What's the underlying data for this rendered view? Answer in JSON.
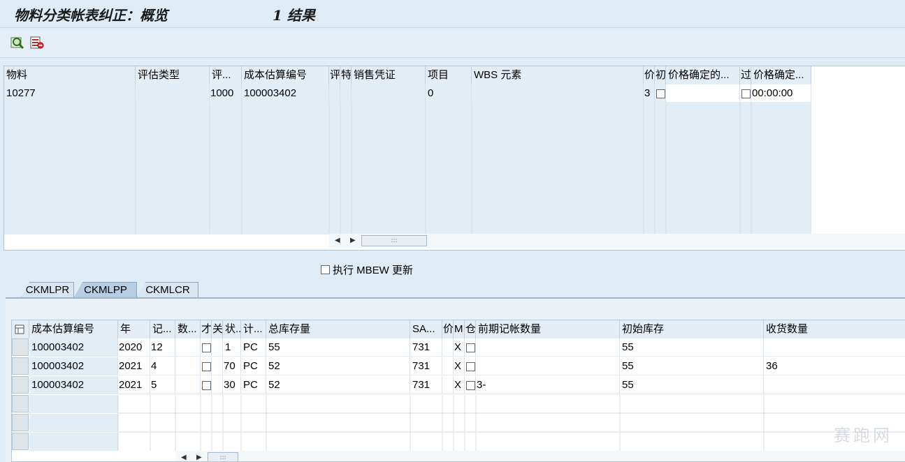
{
  "header": {
    "title": "物料分类帐表纠正：概览",
    "results": "1 结果"
  },
  "toolbar": {
    "buttons": [
      {
        "icon": "zoom-details-icon"
      },
      {
        "icon": "layout-list-icon"
      }
    ]
  },
  "top_table": {
    "columns": [
      "物料",
      "评估类型",
      "评...",
      "成本估算编号",
      "评",
      "特",
      "销售凭证",
      "项目",
      "WBS 元素",
      "价",
      "初",
      "价格确定的...",
      "过",
      "价格确定..."
    ],
    "rows": [
      [
        "10277",
        "",
        "1000",
        "100003402",
        "",
        "",
        "",
        "0",
        "",
        "3",
        "",
        "",
        "",
        "00:00:00"
      ]
    ]
  },
  "mbew_option": {
    "label": "执行 MBEW 更新",
    "checked": false
  },
  "tabs": [
    {
      "label": "CKMLPR"
    },
    {
      "label": "CKMLPP",
      "active": true
    },
    {
      "label": "CKMLCR"
    }
  ],
  "bottom_table": {
    "columns": [
      "成本估算编号",
      "年",
      "记...",
      "数...",
      "才",
      "关",
      "状...",
      "计...",
      "总库存量",
      "SA...",
      "价",
      "M",
      "仓",
      "前期记帐数量",
      "初始库存",
      "收货数量"
    ],
    "rows": [
      [
        "100003402",
        "2020",
        "12",
        "",
        "",
        "",
        "1",
        "PC",
        "55",
        "731",
        "",
        "X",
        "",
        "",
        "55",
        ""
      ],
      [
        "100003402",
        "2021",
        "4",
        "",
        "",
        "",
        "70",
        "PC",
        "52",
        "731",
        "",
        "X",
        "",
        "",
        "55",
        "36"
      ],
      [
        "100003402",
        "2021",
        "5",
        "",
        "",
        "",
        "30",
        "PC",
        "52",
        "731",
        "",
        "X",
        "",
        "3-",
        "55",
        ""
      ]
    ]
  },
  "watermark": "赛跑网"
}
